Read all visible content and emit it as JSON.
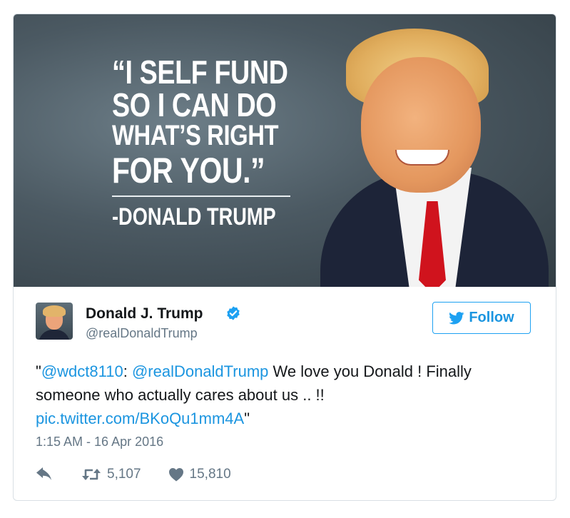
{
  "media": {
    "quote_lines": [
      "“I SELF FUND",
      "SO I CAN DO",
      "WHAT’S RIGHT",
      "FOR YOU.”"
    ],
    "attribution": "-DONALD TRUMP"
  },
  "tweet": {
    "name": "Donald J. Trump",
    "handle": "@realDonaldTrump",
    "follow_label": "Follow",
    "text": {
      "open_quote": "\"",
      "mention1": "@wdct8110",
      "sep": ": ",
      "mention2": "@realDonaldTrump",
      "body": " We love you Donald ! Finally someone who actually cares about us .. !! ",
      "link": "pic.twitter.com/BKoQu1mm4A",
      "close_quote": "\""
    },
    "timestamp": "1:15 AM - 16 Apr 2016",
    "retweets": "5,107",
    "likes": "15,810"
  },
  "icons": [
    "verified-badge-icon",
    "twitter-bird-icon",
    "reply-icon",
    "retweet-icon",
    "heart-icon"
  ],
  "colors": {
    "link": "#1b95e0",
    "verified": "#1da1f2",
    "meta": "#657786",
    "tie": "#d0131d"
  }
}
